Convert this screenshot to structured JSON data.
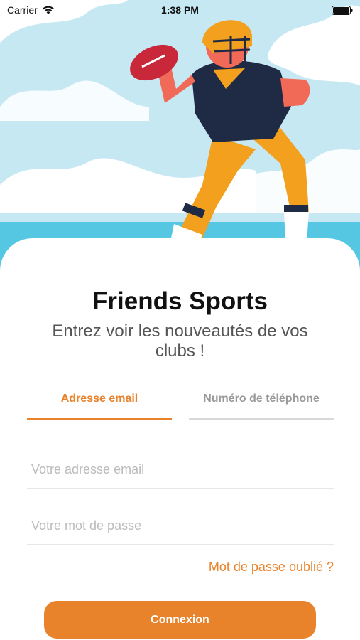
{
  "status_bar": {
    "carrier": "Carrier",
    "time": "1:38 PM",
    "wifi_icon": "wifi-icon",
    "battery_icon": "battery-icon"
  },
  "hero": {
    "illustration": "football-player-illustration",
    "colors": {
      "sky": "#c6e8f3",
      "sea": "#56c7e3",
      "clouds": "#ffffff"
    }
  },
  "app": {
    "title": "Friends Sports",
    "subtitle": "Entrez voir les nouveautés de vos clubs !"
  },
  "tabs": [
    {
      "label": "Adresse email",
      "active": true
    },
    {
      "label": "Numéro de téléphone",
      "active": false
    }
  ],
  "form": {
    "email_placeholder": "Votre adresse email",
    "password_placeholder": "Votre mot de passe",
    "forgot_password": "Mot de passe oublié ?",
    "submit_label": "Connexion"
  },
  "colors": {
    "accent": "#e8822b",
    "inactive_tab": "#999999"
  }
}
